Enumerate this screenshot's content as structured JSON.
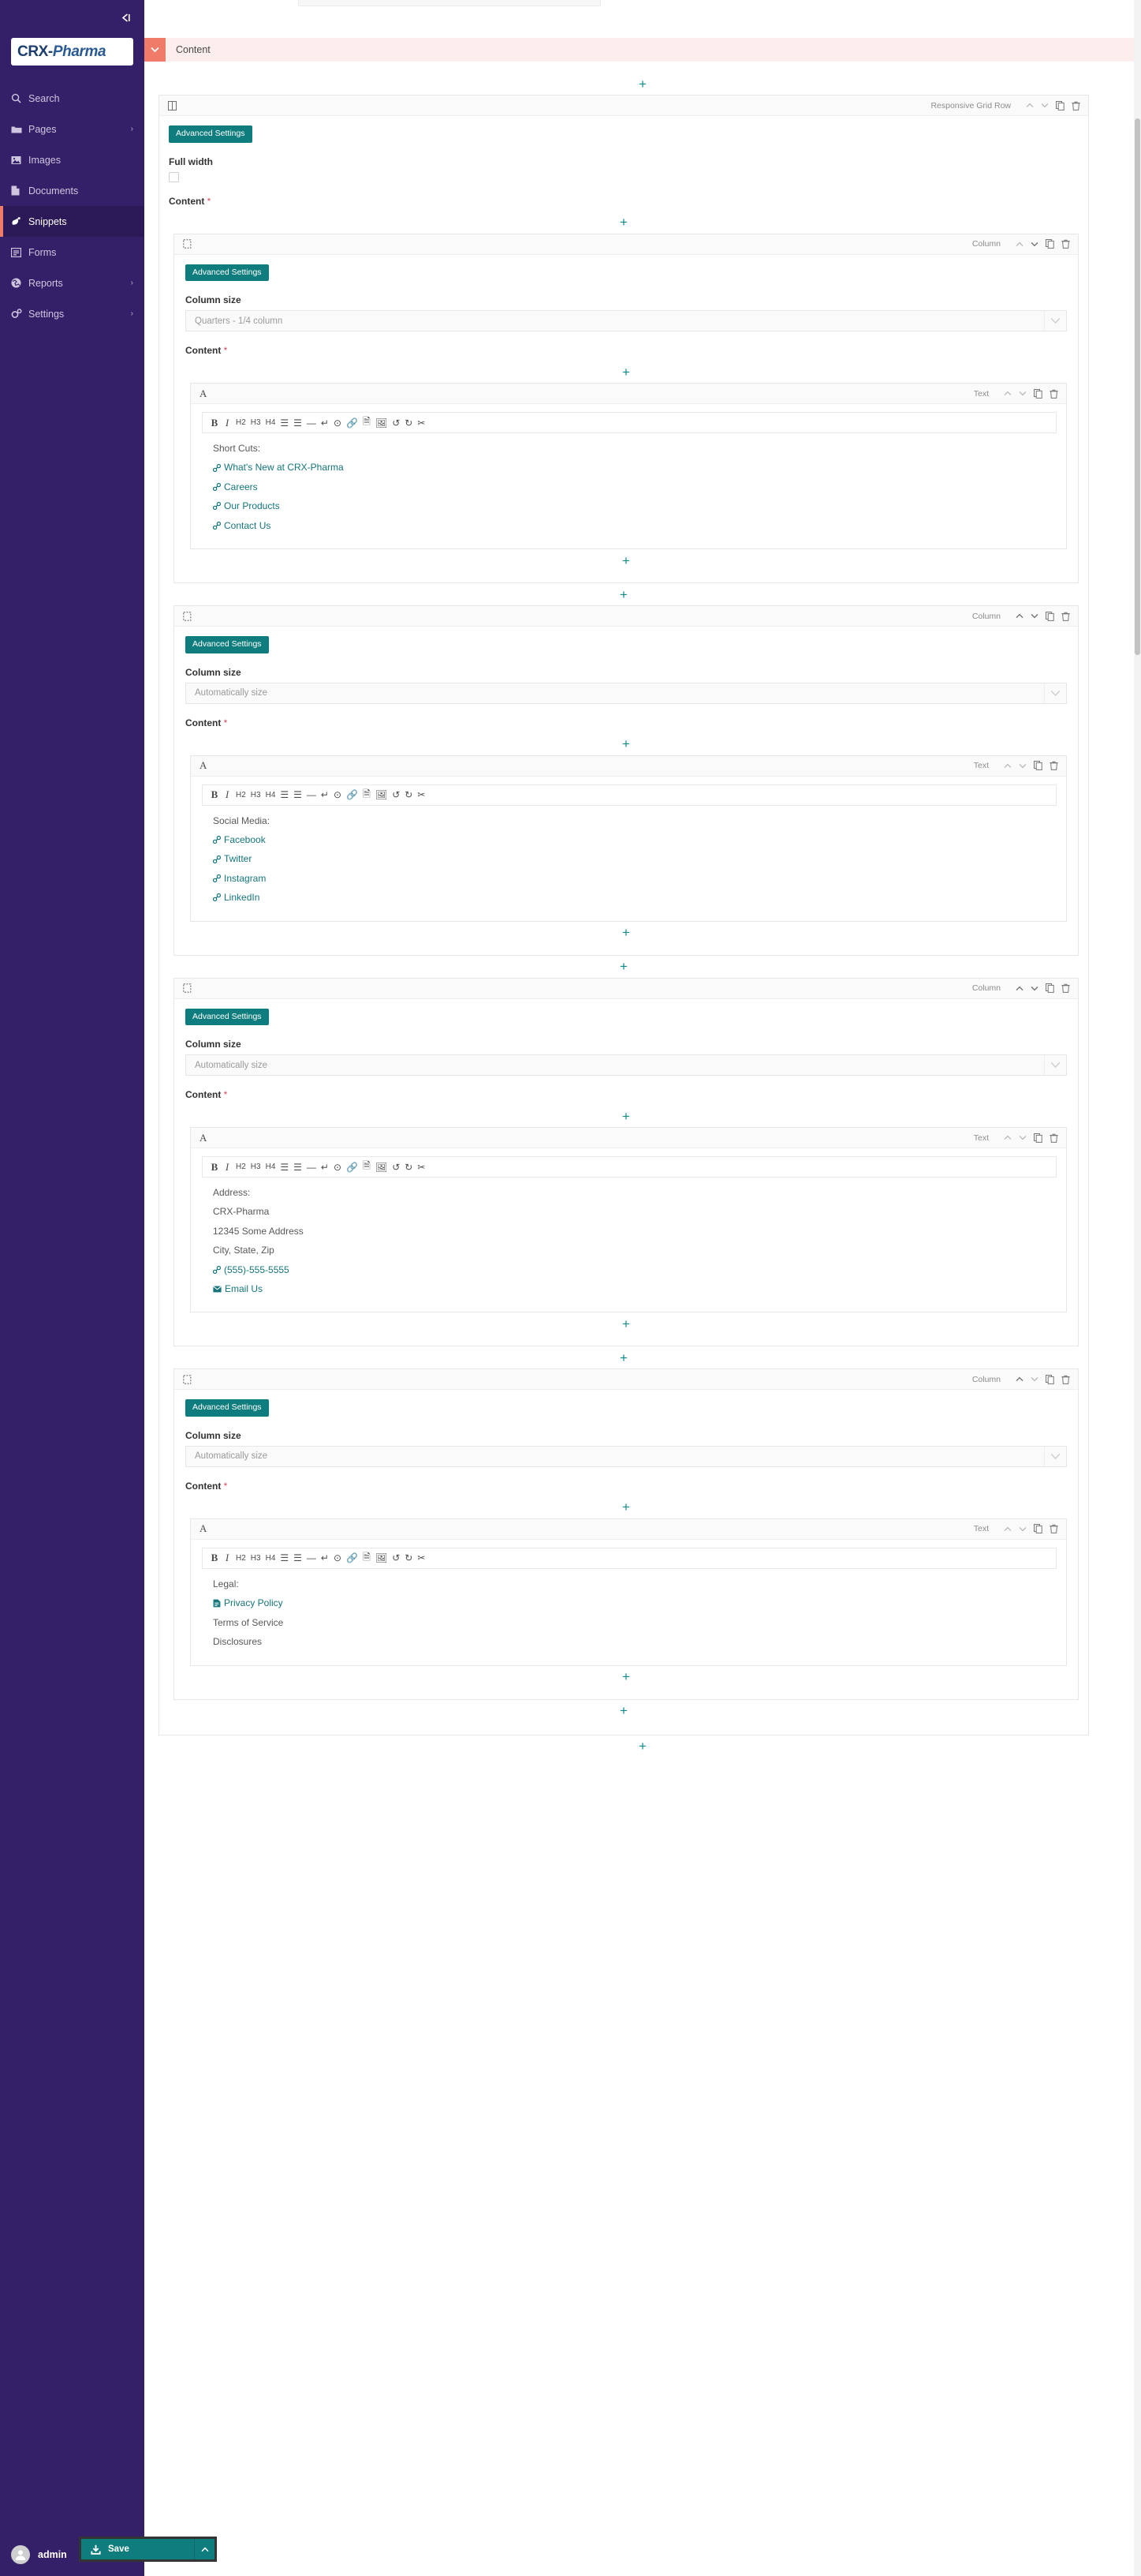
{
  "sidebar": {
    "collapse_icon": "collapse-left-icon",
    "logo_primary": "CRX-",
    "logo_secondary": "Pharma",
    "items": [
      {
        "label": "Search",
        "icon": "search-icon",
        "chevron": "",
        "active": false
      },
      {
        "label": "Pages",
        "icon": "folder-icon",
        "chevron": "›",
        "active": false
      },
      {
        "label": "Images",
        "icon": "image-icon",
        "chevron": "",
        "active": false
      },
      {
        "label": "Documents",
        "icon": "document-icon",
        "chevron": "",
        "active": false
      },
      {
        "label": "Snippets",
        "icon": "snippet-icon",
        "chevron": "",
        "active": true
      },
      {
        "label": "Forms",
        "icon": "form-icon",
        "chevron": "",
        "active": false
      },
      {
        "label": "Reports",
        "icon": "globe-icon",
        "chevron": "›",
        "active": false
      },
      {
        "label": "Settings",
        "icon": "gear-icon",
        "chevron": "›",
        "active": false
      }
    ],
    "user": {
      "name": "admin",
      "chevron": "⌃",
      "avatar_icon": "user-avatar-icon"
    }
  },
  "accordion": {
    "title": "Content",
    "toggle_icon": "chevron-down-icon"
  },
  "add_label": "+",
  "labels": {
    "advanced_settings": "Advanced Settings",
    "full_width": "Full width",
    "content": "Content",
    "required_mark": "*",
    "column_size": "Column size"
  },
  "types": {
    "grid_row": "Responsive Grid Row",
    "column": "Column",
    "text": "Text"
  },
  "block_controls": {
    "up_icon": "chevron-up-icon",
    "down_icon": "chevron-down-icon",
    "copy_icon": "copy-icon",
    "delete_icon": "trash-icon"
  },
  "toolbar_buttons": [
    {
      "label": "B",
      "name": "bold-button",
      "kind": "b"
    },
    {
      "label": "I",
      "name": "italic-button",
      "kind": "i"
    },
    {
      "label": "H2",
      "name": "heading2-button",
      "kind": "h"
    },
    {
      "label": "H3",
      "name": "heading3-button",
      "kind": "h"
    },
    {
      "label": "H4",
      "name": "heading4-button",
      "kind": "h"
    },
    {
      "label": "☰",
      "name": "ordered-list-button",
      "kind": "glyph"
    },
    {
      "label": "☰",
      "name": "unordered-list-button",
      "kind": "glyph"
    },
    {
      "label": "—",
      "name": "horizontal-rule-button",
      "kind": "glyph"
    },
    {
      "label": "↵",
      "name": "line-break-button",
      "kind": "glyph"
    },
    {
      "label": "⊙",
      "name": "media-button",
      "kind": "glyph"
    },
    {
      "label": "🔗",
      "name": "link-button",
      "kind": "glyph"
    },
    {
      "label": "🗎",
      "name": "document-link-button",
      "kind": "glyph"
    },
    {
      "label": "🖼",
      "name": "image-button",
      "kind": "glyph"
    },
    {
      "label": "↺",
      "name": "undo-button",
      "kind": "glyph"
    },
    {
      "label": "↻",
      "name": "redo-button",
      "kind": "glyph"
    },
    {
      "label": "✂",
      "name": "remove-format-button",
      "kind": "glyph"
    }
  ],
  "grid_row": {
    "type": "Responsive Grid Row",
    "full_width_checked": false
  },
  "columns": [
    {
      "column_size": "Quarters - 1/4 column",
      "editor": {
        "type": "Text",
        "lines": [
          {
            "text": "Short Cuts:",
            "link": false,
            "icon": ""
          },
          {
            "text": "What's New at CRX-Pharma",
            "link": true,
            "icon": "link-icon"
          },
          {
            "text": "Careers",
            "link": true,
            "icon": "link-icon"
          },
          {
            "text": "Our Products",
            "link": true,
            "icon": "link-icon"
          },
          {
            "text": "Contact Us",
            "link": true,
            "icon": "link-icon"
          }
        ]
      }
    },
    {
      "column_size": "Automatically size",
      "editor": {
        "type": "Text",
        "lines": [
          {
            "text": "Social Media:",
            "link": false,
            "icon": ""
          },
          {
            "text": "Facebook",
            "link": true,
            "icon": "link-icon"
          },
          {
            "text": "Twitter",
            "link": true,
            "icon": "link-icon"
          },
          {
            "text": "Instagram",
            "link": true,
            "icon": "link-icon"
          },
          {
            "text": "LinkedIn",
            "link": true,
            "icon": "link-icon"
          }
        ]
      }
    },
    {
      "column_size": "Automatically size",
      "editor": {
        "type": "Text",
        "lines": [
          {
            "text": "Address:",
            "link": false,
            "icon": ""
          },
          {
            "text": "CRX-Pharma",
            "link": false,
            "icon": ""
          },
          {
            "text": "12345 Some Address",
            "link": false,
            "icon": ""
          },
          {
            "text": "City, State, Zip",
            "link": false,
            "icon": ""
          },
          {
            "text": "(555)-555-5555",
            "link": true,
            "icon": "link-icon"
          },
          {
            "text": "Email Us",
            "link": true,
            "icon": "mail-icon"
          }
        ]
      }
    },
    {
      "column_size": "Automatically size",
      "editor": {
        "type": "Text",
        "lines": [
          {
            "text": "Legal:",
            "link": false,
            "icon": ""
          },
          {
            "text": "Privacy Policy",
            "link": true,
            "icon": "document-icon"
          },
          {
            "text": "Terms of Service",
            "link": false,
            "icon": ""
          },
          {
            "text": "Disclosures",
            "link": false,
            "icon": ""
          }
        ]
      }
    }
  ],
  "save": {
    "label": "Save",
    "icon": "save-download-icon",
    "caret": "⌃"
  },
  "colors": {
    "sidebar_bg": "#342068",
    "sidebar_active_bg": "#2b1a57",
    "accent_coral": "#ef7b68",
    "accent_teal": "#0f7d7e",
    "link_teal": "#15757b",
    "accordion_bg": "#fbeeec"
  }
}
